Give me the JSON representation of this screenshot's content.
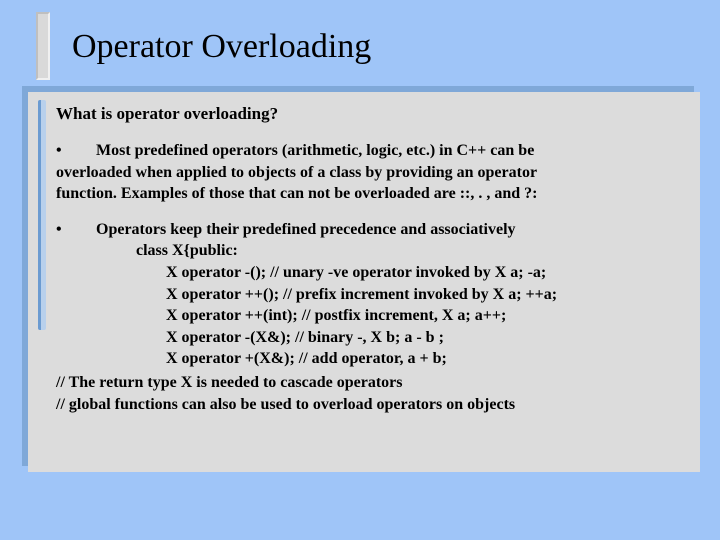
{
  "title": "Operator Overloading",
  "heading": "What is operator overloading?",
  "bullet1_line1": "Most predefined operators (arithmetic, logic, etc.) in C++ can be",
  "bullet1_line2": "overloaded when applied to objects of  a class by providing an operator",
  "bullet1_line3": "function. Examples of those that can not  be overloaded are ::, . ,  and ?:",
  "bullet2_line1": "Operators keep their predefined precedence and associatively",
  "code": {
    "l1": "class X{public:",
    "l2": "X operator -(); // unary -ve operator invoked by X a; -a;",
    "l3": "X operator ++(); // prefix increment invoked by X a; ++a;",
    "l4": "X operator ++(int); // postfix increment, X a; a++;",
    "l5": "X operator -(X&); // binary -, X b; a - b ;",
    "l6": "X operator +(X&); // add operator,  a + b;"
  },
  "comment1": "// The return type X is needed to cascade operators",
  "comment2": "// global functions can also be used to overload operators on objects"
}
